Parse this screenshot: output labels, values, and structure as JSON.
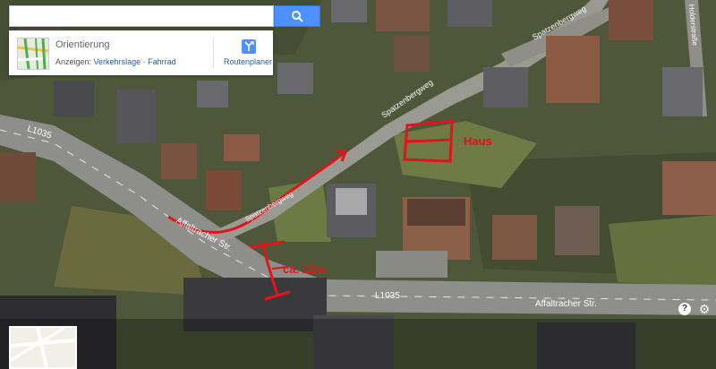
{
  "search": {
    "value": "",
    "placeholder": ""
  },
  "card": {
    "title": "Orientierung",
    "show_label": "Anzeigen:",
    "link_traffic": "Verkehrslage",
    "link_separator": "·",
    "link_bike": "Fahrrad",
    "route_label": "Routenplaner"
  },
  "map_labels": {
    "road_l1035_left": "L1035",
    "road_l1035_center": "L1035",
    "street_affalt_left": "Affaltracher Str.",
    "street_affalt_right": "Affaltracher Str.",
    "street_spatzen_upper": "Spatzenbergweg",
    "street_spatzen_mid": "Spatzenbergweg",
    "street_spatzen_lower": "Spatzenbergweg",
    "street_holder": "Holderstraße"
  },
  "annotations": {
    "haus": "Haus",
    "distance": "ca. 12m"
  },
  "controls": {
    "help": "?",
    "gear": "⚙"
  },
  "colors": {
    "annotation": "#e0141b",
    "search_button": "#4d90fe",
    "link": "#1a5fc4"
  }
}
